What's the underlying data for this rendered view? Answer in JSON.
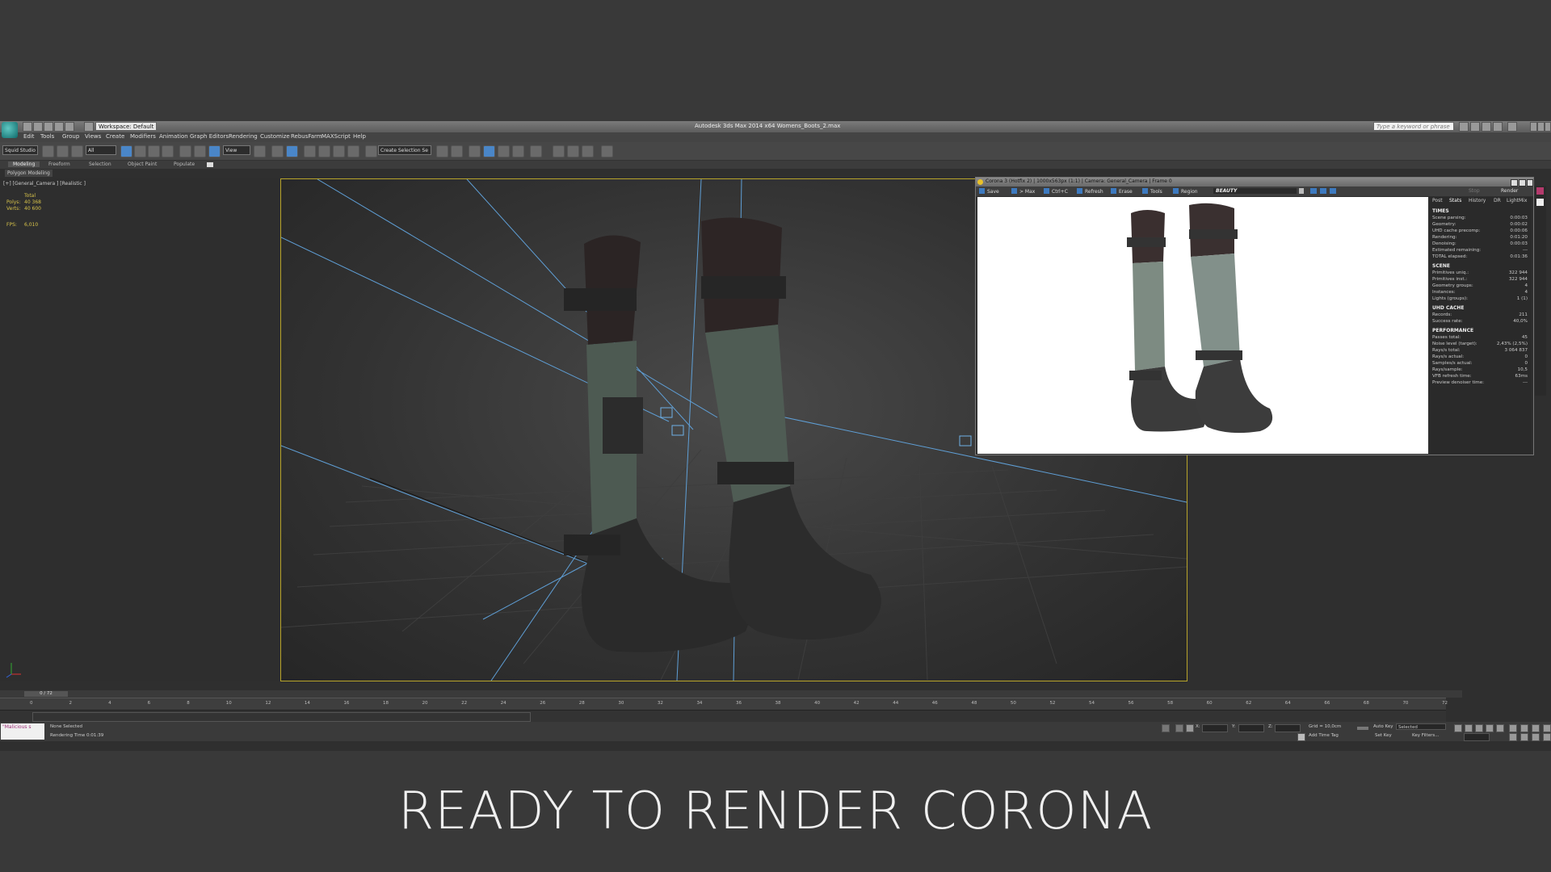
{
  "window": {
    "title": "Autodesk 3ds Max  2014 x64     Womens_Boots_2.max",
    "workspace": "Workspace: Default",
    "search_placeholder": "Type a keyword or phrase"
  },
  "menu": [
    "Edit",
    "Tools",
    "Group",
    "Views",
    "Create",
    "Modifiers",
    "Animation",
    "Graph Editors",
    "Rendering",
    "Customize",
    "RebusFarm",
    "MAXScript",
    "Help"
  ],
  "toolbar": {
    "squid": "Squid Studio v",
    "filter": "All",
    "view": "View",
    "selection_set": "Create Selection Se"
  },
  "ribbon": {
    "tabs": [
      "Modeling",
      "Freeform",
      "Selection",
      "Object Paint",
      "Populate"
    ],
    "polygon_modeling": "Polygon Modeling"
  },
  "viewport": {
    "label": "[+] [General_Camera ] [Realistic ]",
    "stats": {
      "total_label": "Total",
      "polys_label": "Polys:",
      "polys_value": "40 368",
      "verts_label": "Verts:",
      "verts_value": "40 600",
      "fps_label": "FPS:",
      "fps_value": "6,010"
    }
  },
  "vfb": {
    "title": "Corona 3 (Hotfix 2) | 1000x563px (1:1) | Camera: General_Camera | Frame 0",
    "buttons": [
      "Save",
      "> Max",
      "Ctrl+C",
      "Refresh",
      "Erase",
      "Tools",
      "Region"
    ],
    "render_element": "BEAUTY",
    "stop_label": "Stop",
    "render_label": "Render",
    "tabs": [
      "Post",
      "Stats",
      "History",
      "DR",
      "LightMix"
    ],
    "sections": [
      {
        "title": "TIMES",
        "rows": [
          [
            "Scene parsing:",
            "0:00:03"
          ],
          [
            "Geometry:",
            "0:00:02"
          ],
          [
            "UHD cache precomp:",
            "0:00:06"
          ],
          [
            "Rendering:",
            "0:01:20"
          ],
          [
            "Denoising:",
            "0:00:03"
          ],
          [
            "Estimated remaining:",
            "---"
          ],
          [
            "TOTAL elapsed:",
            "0:01:36"
          ]
        ]
      },
      {
        "title": "SCENE",
        "rows": [
          [
            "Primitives uniq.:",
            "322 944"
          ],
          [
            "Primitives inst.:",
            "322 944"
          ],
          [
            "Geometry groups:",
            "4"
          ],
          [
            "Instances:",
            "4"
          ],
          [
            "Lights (groups):",
            "1 (1)"
          ]
        ]
      },
      {
        "title": "UHD CACHE",
        "rows": [
          [
            "Records:",
            "211"
          ],
          [
            "Success rate:",
            "40,0%"
          ]
        ]
      },
      {
        "title": "PERFORMANCE",
        "rows": [
          [
            "Passes total:",
            "45"
          ],
          [
            "Noise level (target):",
            "2,43% (2,5%)"
          ],
          [
            "Rays/s total:",
            "3 064 837"
          ],
          [
            "Rays/s actual:",
            "0"
          ],
          [
            "Samples/s actual:",
            "0"
          ],
          [
            "Rays/sample:",
            "10,5"
          ],
          [
            "VFB refresh time:",
            "63ms"
          ],
          [
            "Preview denoiser time:",
            "---"
          ]
        ]
      }
    ]
  },
  "timeline": {
    "frame": "0 / 72",
    "ticks": [
      "0",
      "2",
      "4",
      "6",
      "8",
      "10",
      "12",
      "14",
      "16",
      "18",
      "20",
      "22",
      "24",
      "26",
      "28",
      "30",
      "32",
      "34",
      "36",
      "38",
      "40",
      "42",
      "44",
      "46",
      "48",
      "50",
      "52",
      "54",
      "56",
      "58",
      "60",
      "62",
      "64",
      "66",
      "68",
      "70",
      "72"
    ]
  },
  "status": {
    "maxscript": "\"Malicious s",
    "selected": "None Selected",
    "render_time": "Rendering Time  0:01:39",
    "x_label": "X:",
    "y_label": "Y:",
    "z_label": "Z:",
    "grid": "Grid = 10,0cm",
    "add_time_tag": "Add Time Tag",
    "auto_key": "Auto Key",
    "auto_key_value": "Selected",
    "set_key": "Set Key",
    "key_filters": "Key Filters..."
  },
  "caption": "READY TO RENDER  CORONA"
}
